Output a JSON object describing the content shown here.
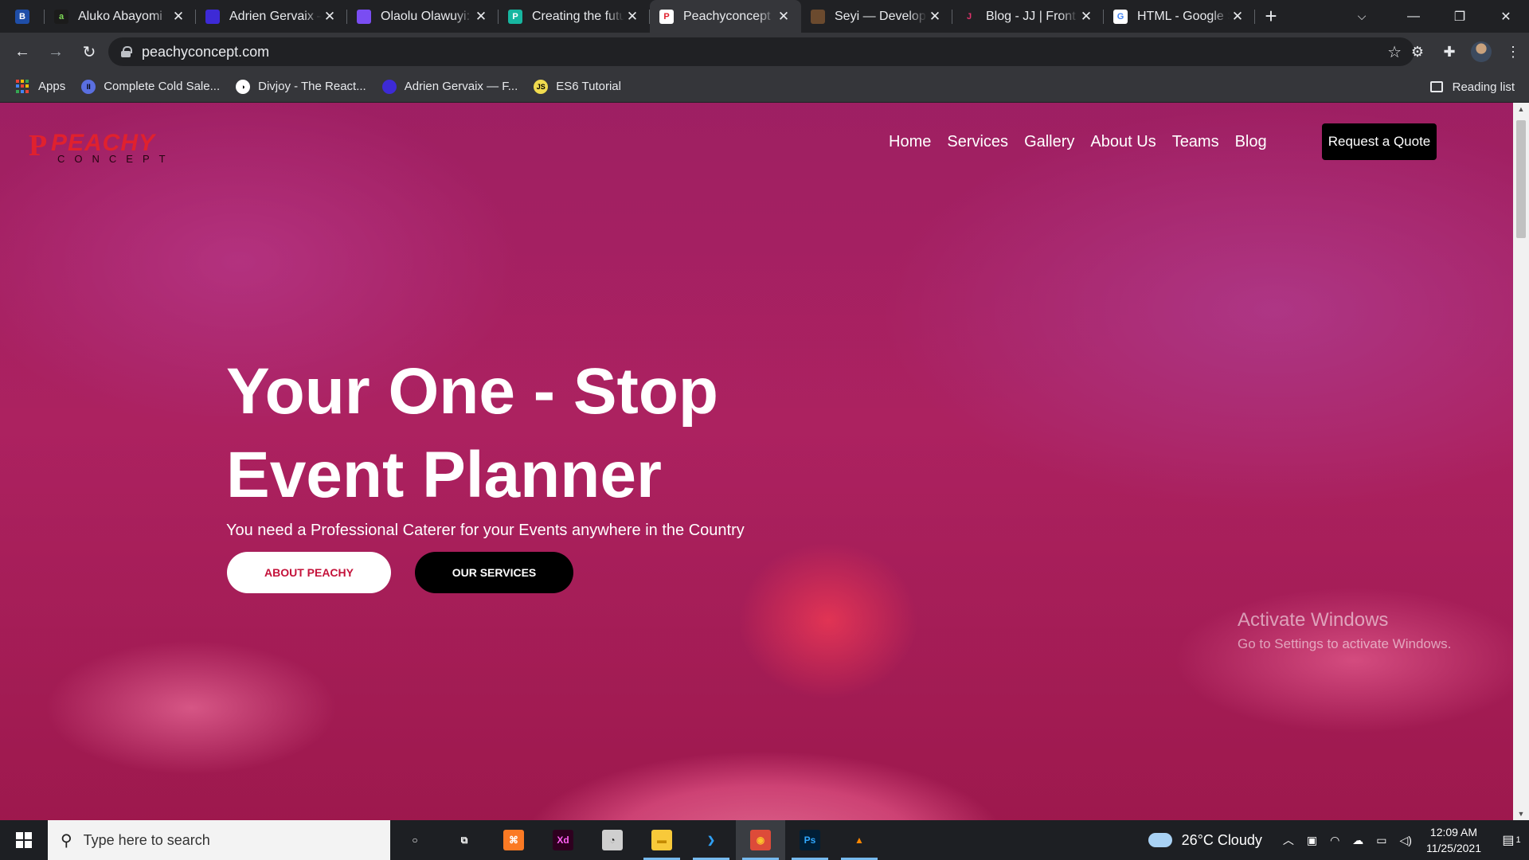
{
  "browser": {
    "pinned_tab": {
      "favicon": "B",
      "color": "#1f4ea8"
    },
    "tabs": [
      {
        "title": "Aluko Abayomi",
        "favicon": "a",
        "color": "#1b1b1b",
        "fav_fg": "#7ed957"
      },
      {
        "title": "Adrien Gervaix –",
        "favicon": "",
        "color": "#3d2ad6",
        "fav_fg": "#fff"
      },
      {
        "title": "Olaolu Olawuyi: I",
        "favicon": "",
        "color": "#7a4df2",
        "fav_fg": "#fff"
      },
      {
        "title": "Creating the futu",
        "favicon": "P",
        "color": "#17b6a0",
        "fav_fg": "#fff"
      },
      {
        "title": "Peachyconcept",
        "favicon": "P",
        "color": "#ffffff",
        "fav_fg": "#e0212e",
        "active": true
      },
      {
        "title": "Seyi — Develope",
        "favicon": "",
        "color": "#6b4a2e",
        "fav_fg": "#fff"
      },
      {
        "title": "Blog - JJ | Front E",
        "favicon": "J",
        "color": "#202124",
        "fav_fg": "#e0336c"
      },
      {
        "title": "HTML - Google S",
        "favicon": "G",
        "color": "#ffffff",
        "fav_fg": "#4285f4"
      }
    ],
    "new_tab": "+",
    "url": "peachyconcept.com",
    "bookmarks": [
      {
        "label": "Apps",
        "icon": "apps-grid-icon"
      },
      {
        "label": "Complete Cold Sale...",
        "icon": "cold-sales-icon",
        "color": "#5a6fe0",
        "glyph": "II"
      },
      {
        "label": "Divjoy - The React...",
        "icon": "divjoy-icon",
        "color": "#ffffff",
        "glyph": "◑"
      },
      {
        "label": "Adrien Gervaix — F...",
        "icon": "adrien-icon",
        "color": "#3d2ad6",
        "glyph": ""
      },
      {
        "label": "ES6 Tutorial",
        "icon": "es6-icon",
        "color": "#f0db4f",
        "glyph": "JS"
      }
    ],
    "reading_list": "Reading list"
  },
  "site": {
    "brand": {
      "mark": "P",
      "name": "PEACHY",
      "tagline": "CONCEPT"
    },
    "nav": [
      "Home",
      "Services",
      "Gallery",
      "About Us",
      "Teams",
      "Blog"
    ],
    "quote_button": "Request a Quote",
    "headline_line1": "Your One - Stop",
    "headline_line2": "Event Planner",
    "subheadline": "You need a Professional Caterer for your Events anywhere in the Country",
    "cta_about": "ABOUT PEACHY",
    "cta_services": "OUR SERVICES",
    "overlay_color": "#c81450"
  },
  "watermark": {
    "title": "Activate Windows",
    "subtitle": "Go to Settings to activate Windows."
  },
  "taskbar": {
    "search_placeholder": "Type here to search",
    "apps": [
      {
        "name": "cortana-icon",
        "glyph": "○",
        "bg": "transparent",
        "fg": "#fff"
      },
      {
        "name": "task-view-icon",
        "glyph": "⧉",
        "bg": "transparent",
        "fg": "#fff"
      },
      {
        "name": "xampp-icon",
        "glyph": "⌘",
        "bg": "#fb7a24",
        "fg": "#fff"
      },
      {
        "name": "adobe-xd-icon",
        "glyph": "Xd",
        "bg": "#2e001f",
        "fg": "#ff61f6"
      },
      {
        "name": "clock-app-icon",
        "glyph": "◔",
        "bg": "#cfcfcf",
        "fg": "#222"
      },
      {
        "name": "file-explorer-icon",
        "glyph": "▬",
        "bg": "#f8c93a",
        "fg": "#c48a00",
        "running": true
      },
      {
        "name": "vscode-icon",
        "glyph": "❯",
        "bg": "transparent",
        "fg": "#2f9ff3",
        "running": true
      },
      {
        "name": "chrome-icon",
        "glyph": "◉",
        "bg": "#dd4b39",
        "fg": "#fbc02d",
        "running": true,
        "focused": true
      },
      {
        "name": "photoshop-icon",
        "glyph": "Ps",
        "bg": "#001e36",
        "fg": "#31a8ff",
        "running": true
      },
      {
        "name": "vlc-icon",
        "glyph": "▲",
        "bg": "transparent",
        "fg": "#ff8800",
        "running": true
      }
    ],
    "weather": "26°C  Cloudy",
    "time": "12:09 AM",
    "date": "11/25/2021",
    "notifications": "1"
  }
}
